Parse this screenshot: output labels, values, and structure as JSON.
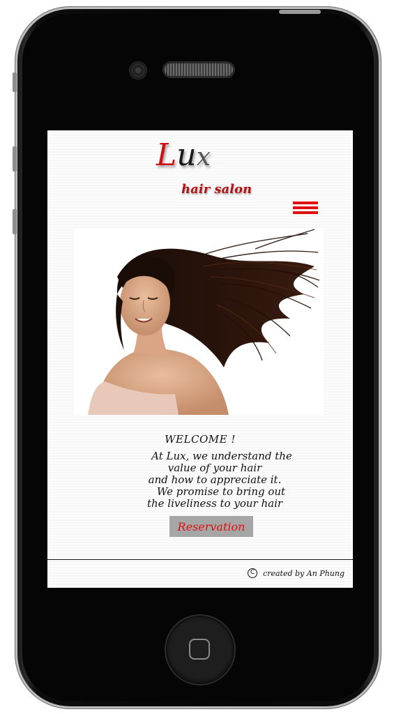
{
  "brand": {
    "logo_letter_1": "L",
    "logo_letter_2": "u",
    "logo_letter_3": "x",
    "tagline": "hair salon",
    "accent_color": "#e01010"
  },
  "nav": {
    "menu_icon": "hamburger-menu-icon"
  },
  "hero": {
    "image": "woman-with-flowing-hair"
  },
  "welcome": {
    "title": "WELCOME !",
    "lines": [
      "At Lux, we understand the",
      "value of your hair",
      "and how to appreciate it.",
      "We promise to bring out",
      "the liveliness to your hair"
    ]
  },
  "cta": {
    "reservation_label": "Reservation"
  },
  "footer": {
    "copyright_symbol": "C",
    "credit": "created by An Phung"
  }
}
